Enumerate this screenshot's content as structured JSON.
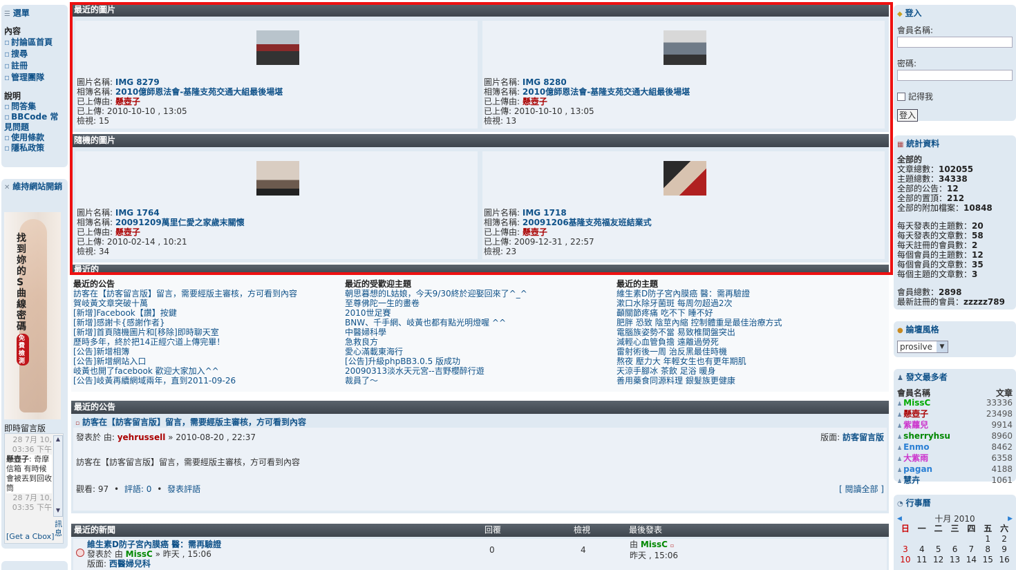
{
  "left_menu": {
    "title": "選單",
    "content_heading": "內容",
    "content_items": [
      "討論區首頁",
      "搜尋",
      "註冊",
      "管理團隊"
    ],
    "help_heading": "說明",
    "help_items": [
      "問答集",
      "BBCode 常見問題",
      "使用條款",
      "隱私政策"
    ]
  },
  "left_ad": {
    "title": "維持網站開銷",
    "ad_text": "找到妳的S曲線密碼",
    "ad_badge": "免費檢測"
  },
  "cbox": {
    "title": "即時留言版",
    "messages": [
      {
        "date": "28 7月 10, 03:36 下午",
        "author": "懸壺子",
        "text": ": 奇摩信箱 有時候會被丟到回收筒"
      },
      {
        "date": "28 7月 10, 03:35 下午",
        "author": "",
        "text": ""
      }
    ],
    "side_label": "訊息",
    "link": "[Get a Cbox]"
  },
  "recent_images": {
    "title": "最近的圖片",
    "items": [
      {
        "name_label": "圖片名稱:",
        "name": "IMG 8279",
        "album_label": "相簿名稱:",
        "album": "2010億師恩法會-基隆支苑交通大組最後場堪",
        "uploader_label": "已上傳由:",
        "uploader": "懸壺子",
        "time_label": "已上傳:",
        "time": "2010-10-10 , 13:05",
        "views_label": "檢視:",
        "views": "15"
      },
      {
        "name_label": "圖片名稱:",
        "name": "IMG 8280",
        "album_label": "相簿名稱:",
        "album": "2010億師恩法會-基隆支苑交通大組最後場堪",
        "uploader_label": "已上傳由:",
        "uploader": "懸壺子",
        "time_label": "已上傳:",
        "time": "2010-10-10 , 13:05",
        "views_label": "檢視:",
        "views": "13"
      }
    ]
  },
  "random_images": {
    "title": "隨機的圖片",
    "items": [
      {
        "name_label": "圖片名稱:",
        "name": "IMG 1764",
        "album_label": "相簿名稱:",
        "album": "20091209萬里仁愛之家歲末關懷",
        "uploader_label": "已上傳由:",
        "uploader": "懸壺子",
        "time_label": "已上傳:",
        "time": "2010-02-14 , 10:21",
        "views_label": "檢視:",
        "views": "34"
      },
      {
        "name_label": "圖片名稱:",
        "name": "IMG 1718",
        "album_label": "相簿名稱:",
        "album": "20091206基隆支苑福友班結業式",
        "uploader_label": "已上傳由:",
        "uploader": "懸壺子",
        "time_label": "已上傳:",
        "time": "2009-12-31 , 22:57",
        "views_label": "檢視:",
        "views": "23"
      }
    ]
  },
  "recent_section": {
    "title": "最近的",
    "columns": [
      {
        "heading": "最近的公告",
        "items": [
          "訪客在【訪客留言版】留言，需要經版主審核，方可看到內容",
          "賀岐黃文章突破十萬",
          "[新增]Facebook【讚】按鍵",
          "[新增]感謝卡{感謝作者}",
          "[新增]首頁隨機圖片和[移除]即時聊天室",
          "歷時多年，終於把14正經穴道上傳完畢！",
          "[公告]新增相簿",
          "[公告]新增網站入口",
          "岐黃也開了facebook 歡迎大家加入^^",
          "[公告]岐黃再續網域兩年，直到2011-09-26"
        ]
      },
      {
        "heading": "最近的受歡迎主題",
        "items": [
          "朝思暮想的L姑娘，今天9/30終於迎娶回來了^_^",
          "至尊佛陀一生的畫卷",
          "2010世足賽",
          "BNW、千手網、岐黃也都有點光明燈喔 ^^",
          "中醫婦科學",
          "急救良方",
          "愛心滿載東海行",
          "[公告]升級phpBB3.0.5 版成功",
          "20090313淡水天元宮--吉野櫻醉行遊",
          "裁員了～"
        ]
      },
      {
        "heading": "最近的主題",
        "items": [
          "維生素D防子宮內膜癌 醫：需再驗證",
          "漱口水除牙菌斑 每周勿超過2次",
          "顳關節疼痛 吃不下 睡不好",
          "肥胖 恐致 陰莖內縮 控制體重是最佳治療方式",
          "電腦族姿勢不當 易致椎間盤突出",
          "減輕心血管負擔 遠離過勞死",
          "雷射術後一周 治反黑最佳時機",
          "熬夜 壓力大 年輕女生也有更年期肌",
          "天涼手腳冰 茶飲 足浴 暖身",
          "善用藥食同源料理 銀髮族更健康"
        ]
      }
    ]
  },
  "announcement": {
    "title": "最近的公告",
    "topic": "訪客在【訪客留言版】留言，需要經版主審核，方可看到內容",
    "posted_label": "發表於 由:",
    "author": "yehrussell",
    "date": "» 2010-08-20 , 22:37",
    "forum_label": "版面:",
    "forum": "訪客留言版",
    "body": "訪客在【訪客留言版】留言，需要經版主審核，方可看到內容",
    "views_label": "觀看:",
    "views": "97",
    "comments_label": "評語:",
    "comments": "0",
    "post_comment": "發表評語",
    "read_all": "[ 閱讀全部 ]"
  },
  "news": {
    "title": "最近的新聞",
    "col_replies": "回覆",
    "col_views": "檢視",
    "col_last": "最後發表",
    "rows": [
      {
        "topic": "維生素D防子宮內膜癌 醫：需再驗證",
        "posted_label": "發表於 由",
        "author": "MissC",
        "time": "» 昨天 , 15:06",
        "forum_label": "版面:",
        "forum": "西醫婦兒科",
        "replies": "0",
        "views": "4",
        "last_by_label": "由",
        "last_by": "MissC",
        "last_time": "昨天 , 15:06"
      }
    ]
  },
  "login": {
    "title": "登入",
    "username_label": "會員名稱:",
    "password_label": "密碼:",
    "remember_label": "記得我",
    "button": "登入"
  },
  "stats": {
    "title": "統計資料",
    "all_heading": "全部的",
    "lines_a": [
      {
        "label": "文章總數：",
        "value": "102055"
      },
      {
        "label": "主題總數：",
        "value": "34338"
      },
      {
        "label": "全部的公告：",
        "value": "12"
      },
      {
        "label": "全部的置頂：",
        "value": "212"
      },
      {
        "label": "全部的附加檔案：",
        "value": "10848"
      }
    ],
    "lines_b": [
      {
        "label": "每天發表的主題數：",
        "value": "20"
      },
      {
        "label": "每天發表的文章數：",
        "value": "58"
      },
      {
        "label": "每天註冊的會員數：",
        "value": "2"
      },
      {
        "label": "每個會員的主題數：",
        "value": "12"
      },
      {
        "label": "每個會員的文章數：",
        "value": "35"
      },
      {
        "label": "每個主題的文章數：",
        "value": "3"
      }
    ],
    "lines_c": [
      {
        "label": "會員總數：",
        "value": "2898"
      },
      {
        "label": "最新註冊的會員：",
        "value": "zzzzz789"
      }
    ]
  },
  "style": {
    "title": "論壇風格",
    "selected": "prosilve"
  },
  "top_posters": {
    "title": "發文最多者",
    "col_name": "會員名稱",
    "col_posts": "文章",
    "rows": [
      {
        "name": "MissC",
        "posts": "33336",
        "color": "#00aa00"
      },
      {
        "name": "懸壺子",
        "posts": "23498",
        "color": "#aa0000"
      },
      {
        "name": "紫蘿兒",
        "posts": "9914",
        "color": "#cc33cc"
      },
      {
        "name": "sherryhsu",
        "posts": "8960",
        "color": "#008800"
      },
      {
        "name": "Enmo",
        "posts": "8462",
        "color": "#2a7fd4"
      },
      {
        "name": "大紫雨",
        "posts": "6358",
        "color": "#cc33cc"
      },
      {
        "name": "pagan",
        "posts": "4188",
        "color": "#2a7fd4"
      },
      {
        "name": "慧卉",
        "posts": "1061",
        "color": "#105289"
      }
    ]
  },
  "calendar": {
    "title": "行事曆",
    "month": "十月 2010",
    "weekdays": [
      "日",
      "一",
      "二",
      "三",
      "四",
      "五",
      "六"
    ],
    "row1": [
      "",
      "",
      "",
      "",
      "",
      "1",
      "2"
    ],
    "row2": [
      "3",
      "4",
      "5",
      "6",
      "7",
      "8",
      "9"
    ],
    "row3": [
      "10",
      "11",
      "12",
      "13",
      "14",
      "15",
      "16"
    ]
  }
}
